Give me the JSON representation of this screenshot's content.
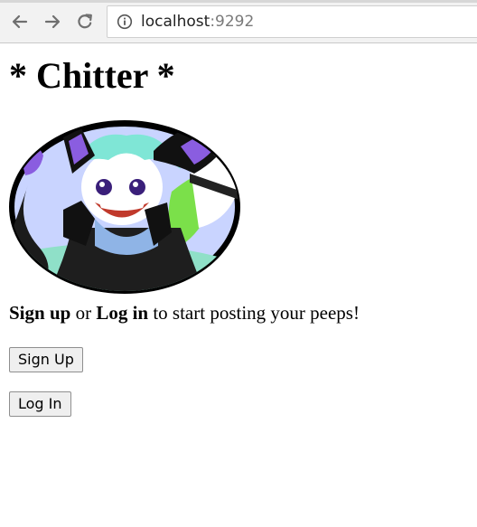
{
  "browser": {
    "url_host": "localhost",
    "url_port": ":9292",
    "back_icon": "arrow-left",
    "forward_icon": "arrow-right",
    "reload_icon": "reload",
    "site_info_icon": "info-circle"
  },
  "page": {
    "title": "* Chitter *",
    "intro": {
      "signup_link": "Sign up",
      "or_text": " or ",
      "login_link": "Log in",
      "rest_text": " to start posting your peeps!"
    },
    "signup_button": "Sign Up",
    "login_button": "Log In"
  }
}
